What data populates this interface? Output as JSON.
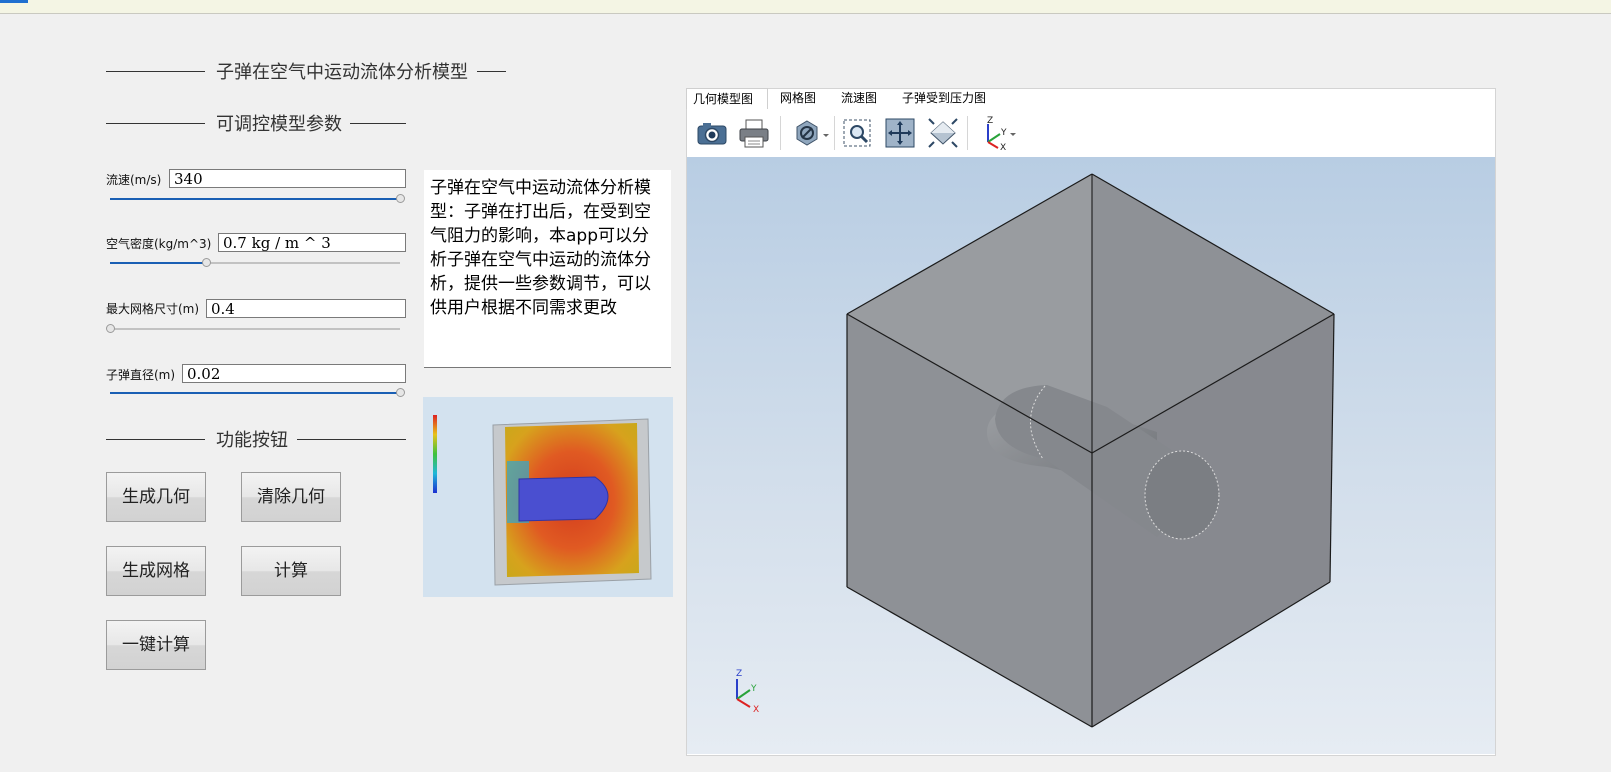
{
  "app": {
    "title": "子弹在空气中运动流体分析模型",
    "params_title": "可调控模型参数",
    "buttons_title": "功能按钮"
  },
  "params": [
    {
      "label": "流速(m/s)",
      "value": "340",
      "slider_fraction": 1.0
    },
    {
      "label": "空气密度(kg/m^3)",
      "value": "0.7 kg / m ^ 3",
      "slider_fraction": 0.33
    },
    {
      "label": "最大网格尺寸(m)",
      "value": "0.4",
      "slider_fraction": 0.0
    },
    {
      "label": "子弹直径(m)",
      "value": "0.02",
      "slider_fraction": 1.0
    }
  ],
  "description": "子弹在空气中运动流体分析模型：子弹在打出后，在受到空气阻力的影响，本app可以分析子弹在空气中运动的流体分析，提供一些参数调节，可以供用户根据不同需求更改",
  "buttons": {
    "generate_geometry": "生成几何",
    "clear_geometry": "清除几何",
    "generate_mesh": "生成网格",
    "compute": "计算",
    "one_click": "一键计算"
  },
  "viewer": {
    "tabs": [
      "几何模型图",
      "网格图",
      "流速图",
      "子弹受到压力图"
    ],
    "active_tab": 0,
    "toolbar_icons": [
      "camera-icon",
      "print-icon",
      "transparency-icon",
      "zoom-box-icon",
      "zoom-extents-icon",
      "scene-light-icon",
      "axis-orientation-icon"
    ]
  },
  "colors": {
    "accent": "#1f6fd0",
    "slider": "#1a5fb4",
    "canvas_top": "#b8cde3",
    "canvas_bottom": "#e6ecf3",
    "geometry": "#8e9196"
  }
}
